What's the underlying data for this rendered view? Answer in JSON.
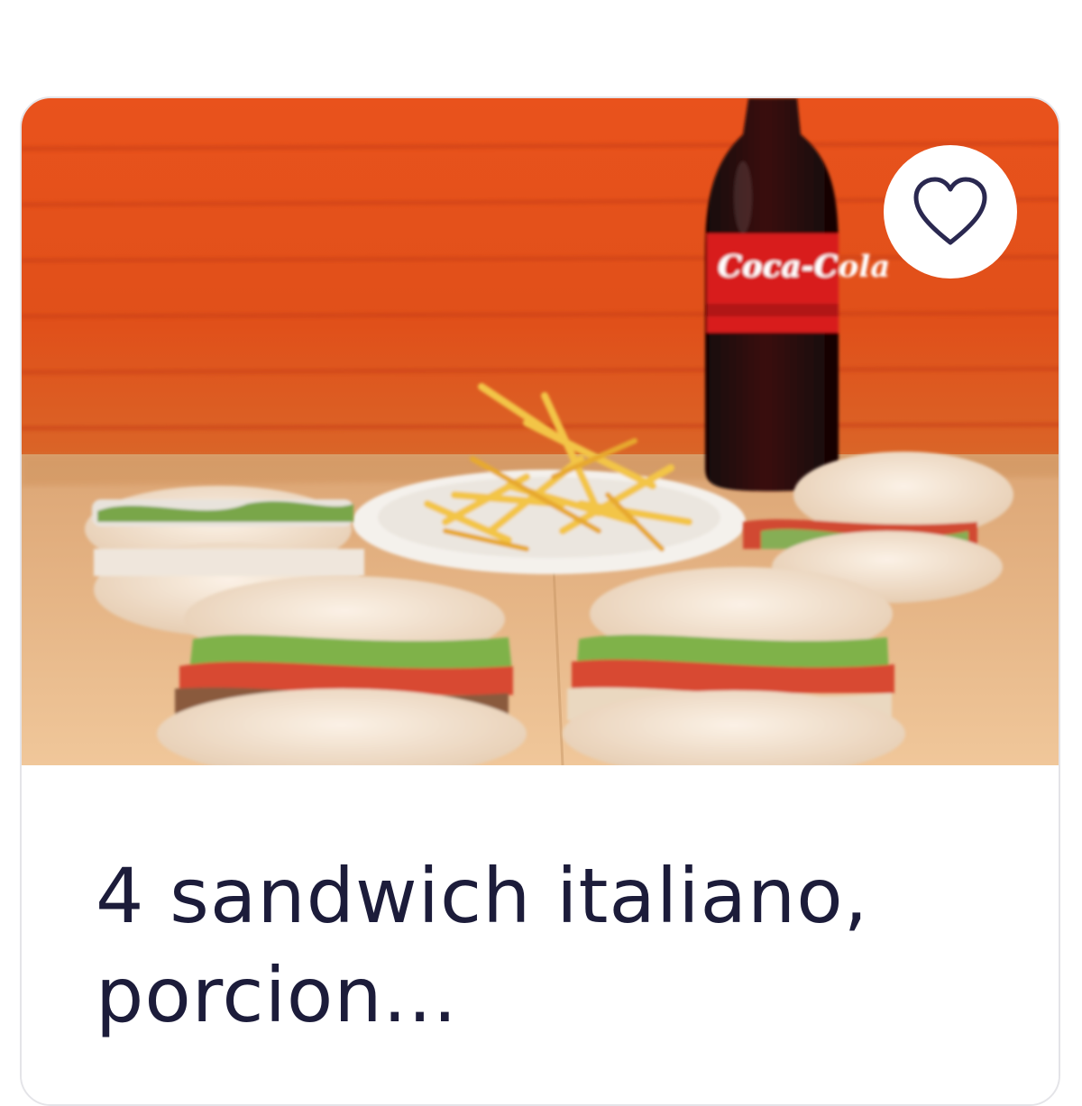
{
  "card": {
    "title": "4 sandwich italiano, porcion...",
    "photo": {
      "brand_label": "Coca-Cola"
    },
    "favorite": {
      "icon": "heart-icon",
      "active": false
    }
  },
  "colors": {
    "title_text": "#1c1c3a",
    "heart_stroke": "#2a2850",
    "card_border": "#e4e4e8",
    "background": "#ffffff"
  }
}
